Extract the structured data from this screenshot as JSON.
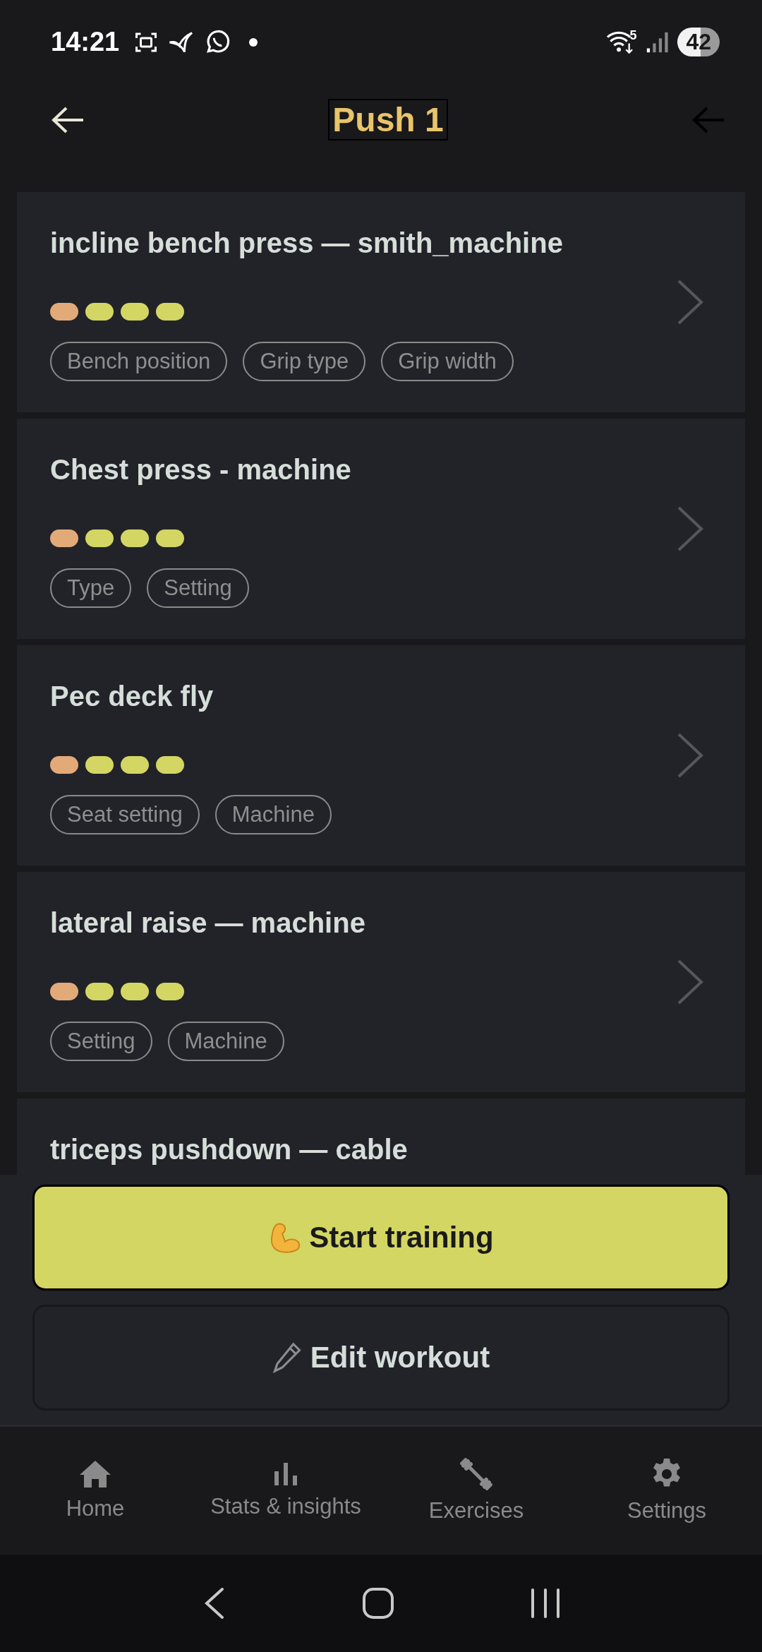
{
  "status_bar": {
    "time": "14:21",
    "wifi_badge": "5",
    "battery": "42"
  },
  "header": {
    "title": "Push 1"
  },
  "exercises": [
    {
      "name": "incline bench press — smith_machine",
      "dots": [
        {
          "color": "#e2aa78"
        },
        {
          "color": "#d3d663"
        },
        {
          "color": "#d3d663"
        },
        {
          "color": "#d3d663"
        }
      ],
      "tags": [
        "Bench position",
        "Grip type",
        "Grip width"
      ]
    },
    {
      "name": "Chest press - machine",
      "dots": [
        {
          "color": "#e2aa78"
        },
        {
          "color": "#d3d663"
        },
        {
          "color": "#d3d663"
        },
        {
          "color": "#d3d663"
        }
      ],
      "tags": [
        "Type",
        "Setting"
      ]
    },
    {
      "name": "Pec deck fly",
      "dots": [
        {
          "color": "#e2aa78"
        },
        {
          "color": "#d3d663"
        },
        {
          "color": "#d3d663"
        },
        {
          "color": "#d3d663"
        }
      ],
      "tags": [
        "Seat setting",
        "Machine"
      ]
    },
    {
      "name": "lateral raise — machine",
      "dots": [
        {
          "color": "#e2aa78"
        },
        {
          "color": "#d3d663"
        },
        {
          "color": "#d3d663"
        },
        {
          "color": "#d3d663"
        }
      ],
      "tags": [
        "Setting",
        "Machine"
      ]
    },
    {
      "name": "triceps pushdown — cable"
    }
  ],
  "actions": [
    {
      "kind": "primary",
      "label": "Start training"
    },
    {
      "kind": "secondary",
      "label": "Edit workout"
    }
  ],
  "nav": [
    {
      "kind": "home",
      "label": "Home"
    },
    {
      "kind": "stats",
      "label": "Stats & insights"
    },
    {
      "kind": "exercises",
      "label": "Exercises"
    },
    {
      "kind": "settings",
      "label": "Settings"
    }
  ]
}
